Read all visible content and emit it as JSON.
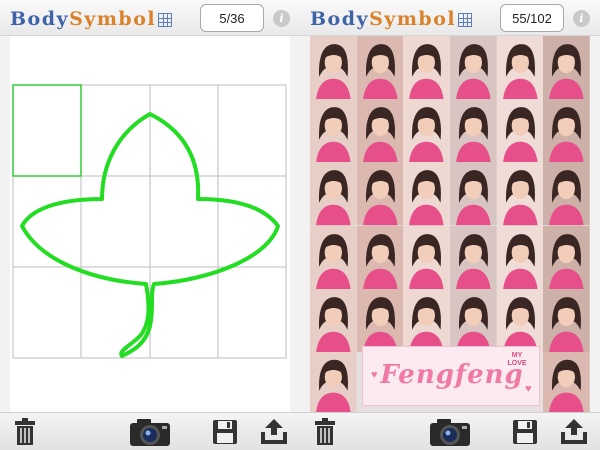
{
  "app": {
    "logo_part1": "Body",
    "logo_part2": "Symbol"
  },
  "left_screen": {
    "counter": "5/36",
    "info_label": "i",
    "shape": "leaf",
    "grid": {
      "columns": 4,
      "rows": 3
    },
    "highlight_cell": {
      "row": 1,
      "col": 1
    },
    "outline_color": "#22dd22"
  },
  "right_screen": {
    "counter": "55/102",
    "info_label": "i",
    "banner": {
      "text": "Fengfeng",
      "tag_line1": "MY",
      "tag_line2": "LOVE"
    },
    "grid": {
      "columns": 6,
      "rows": 6
    },
    "accent_color": "#e64f8a"
  },
  "toolbar": {
    "trash_icon": "trash-icon",
    "camera_icon": "camera-icon",
    "save_icon": "floppy-disk-icon",
    "share_icon": "share-upload-icon"
  }
}
